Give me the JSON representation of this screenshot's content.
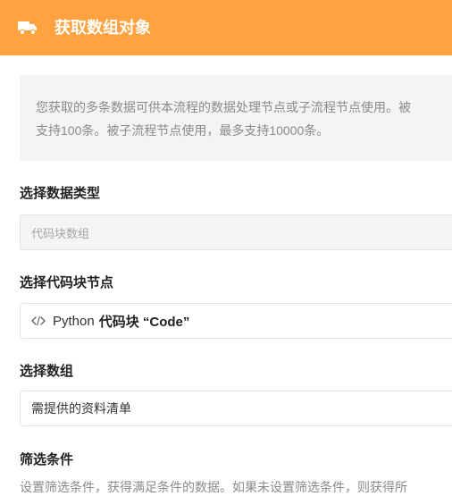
{
  "header": {
    "icon": "truck-icon",
    "title": "获取数组对象",
    "bg_color": "#FFA23F"
  },
  "notice": {
    "line1": "您获取的多条数据可供本流程的数据处理节点或子流程节点使用。被",
    "line2": "支持100条。被子流程节点使用，最多支持10000条。"
  },
  "data_type": {
    "label": "选择数据类型",
    "value": "代码块数组"
  },
  "code_node": {
    "label": "选择代码块节点",
    "icon": "code-icon",
    "language": "Python",
    "name": "代码块 “Code”"
  },
  "array": {
    "label": "选择数组",
    "value": "需提供的资料清单"
  },
  "filter": {
    "label": "筛选条件",
    "description": "设置筛选条件，获得满足条件的数据。如果未设置筛选条件，则获得所"
  }
}
